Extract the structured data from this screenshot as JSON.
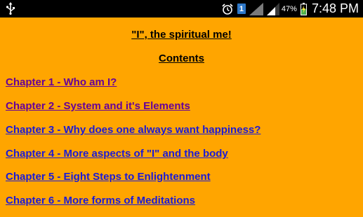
{
  "status_bar": {
    "sim_slot": "1",
    "battery_percent": "47%",
    "time": "7:48 PM",
    "icons": [
      "usb-icon",
      "alarm-clock-icon",
      "sim-1-icon",
      "signal-gray-icon",
      "signal-icon",
      "battery-charging-icon"
    ]
  },
  "page": {
    "title": "\"I\", the spiritual me!",
    "contents_heading": "Contents",
    "background_color": "#ffa500"
  },
  "chapters": [
    {
      "label": "Chapter 1 - Who am I?",
      "visited": true
    },
    {
      "label": "Chapter 2 - System and it's Elements",
      "visited": true
    },
    {
      "label": "Chapter 3 - Why does one always want happiness?",
      "visited": false
    },
    {
      "label": "Chapter 4 - More aspects of \"I\" and the body",
      "visited": false
    },
    {
      "label": "Chapter 5 - Eight Steps to Enlightenment",
      "visited": false
    },
    {
      "label": "Chapter 6 - More forms of Meditations",
      "visited": false
    }
  ],
  "colors": {
    "visited_link": "#660099",
    "unvisited_link": "#1a1ad8",
    "status_bar": "#000000"
  }
}
